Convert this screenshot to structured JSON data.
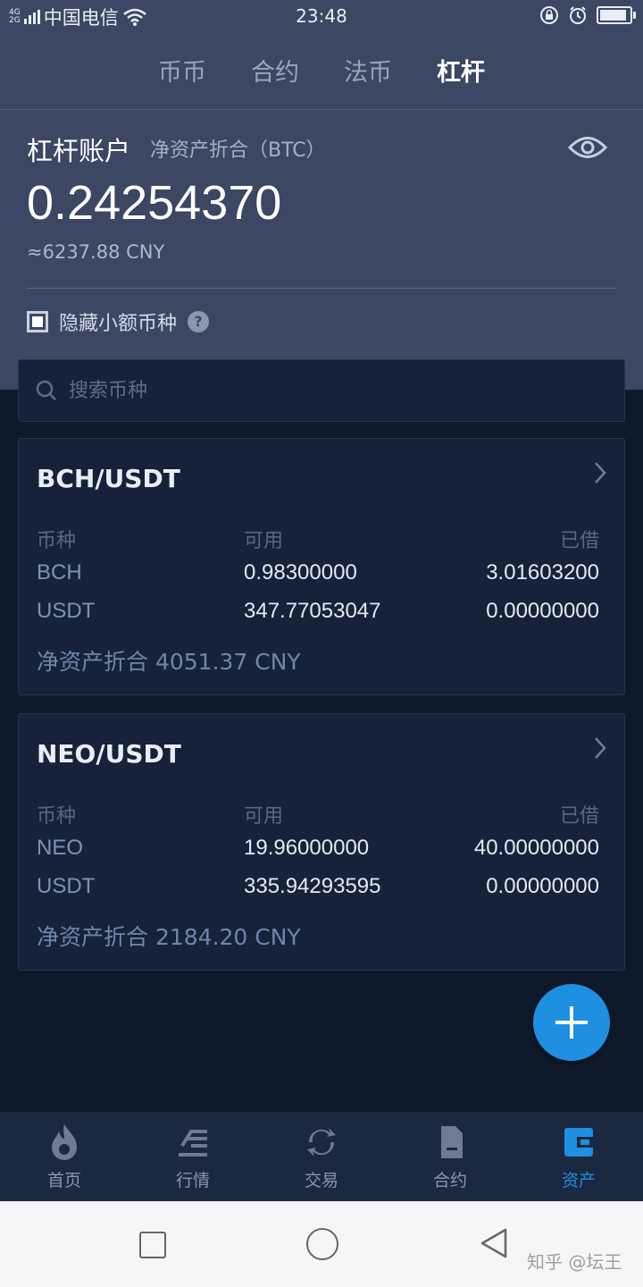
{
  "status_bar": {
    "network_top": "4G",
    "network_bottom": "2G",
    "carrier": "中国电信",
    "time": "23:48",
    "icons": [
      "signal-icon",
      "wifi-icon",
      "rotation-lock-icon",
      "alarm-icon",
      "battery-icon"
    ],
    "battery_level": 0.95
  },
  "tabs": [
    {
      "label": "币币",
      "active": false
    },
    {
      "label": "合约",
      "active": false
    },
    {
      "label": "法币",
      "active": false
    },
    {
      "label": "杠杆",
      "active": true
    }
  ],
  "account": {
    "title": "杠杆账户",
    "subtitle": "净资产折合（BTC）",
    "balance": "0.24254370",
    "balance_cny": "≈6237.88 CNY",
    "hide_small_label": "隐藏小额币种",
    "hide_small_checked": true,
    "help_symbol": "?"
  },
  "search": {
    "placeholder": "搜索币种"
  },
  "pairs": [
    {
      "title": "BCH/USDT",
      "headers": [
        "币种",
        "可用",
        "已借"
      ],
      "rows": [
        {
          "coin": "BCH",
          "available": "0.98300000",
          "borrowed": "3.01603200"
        },
        {
          "coin": "USDT",
          "available": "347.77053047",
          "borrowed": "0.00000000"
        }
      ],
      "net_value": "净资产折合 4051.37 CNY"
    },
    {
      "title": "NEO/USDT",
      "headers": [
        "币种",
        "可用",
        "已借"
      ],
      "rows": [
        {
          "coin": "NEO",
          "available": "19.96000000",
          "borrowed": "40.00000000"
        },
        {
          "coin": "USDT",
          "available": "335.94293595",
          "borrowed": "0.00000000"
        }
      ],
      "net_value": "净资产折合 2184.20 CNY"
    }
  ],
  "bottom_nav": [
    {
      "label": "首页",
      "icon": "flame-icon",
      "active": false
    },
    {
      "label": "行情",
      "icon": "market-icon",
      "active": false
    },
    {
      "label": "交易",
      "icon": "exchange-icon",
      "active": false
    },
    {
      "label": "合约",
      "icon": "contract-icon",
      "active": false
    },
    {
      "label": "资产",
      "icon": "wallet-icon",
      "active": true
    }
  ],
  "watermark": "知乎 @坛王",
  "colors": {
    "header_bg": "#3b4763",
    "page_bg": "#0e1a2b",
    "card_bg": "#16223a",
    "accent": "#1e8fe1",
    "muted_blue": "#7d93b5"
  }
}
